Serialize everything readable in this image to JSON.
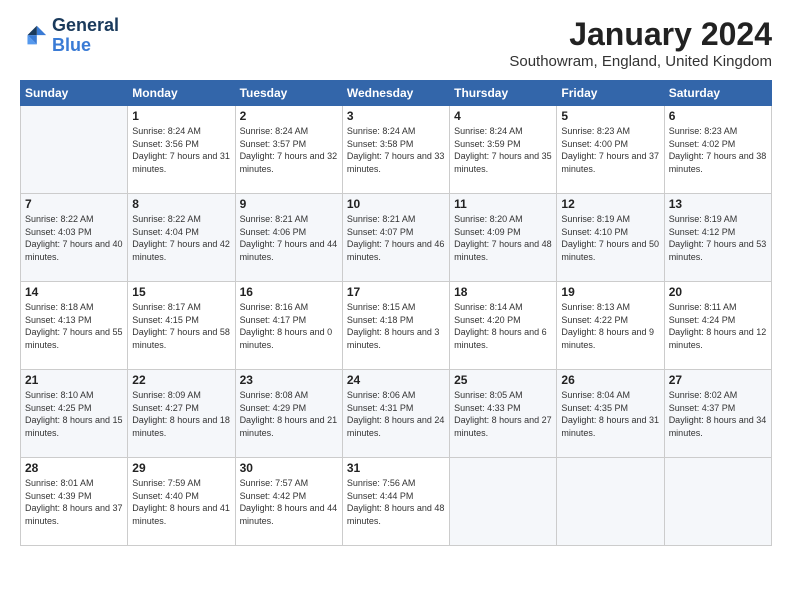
{
  "header": {
    "logo_line1": "General",
    "logo_line2": "Blue",
    "month": "January 2024",
    "location": "Southowram, England, United Kingdom"
  },
  "weekdays": [
    "Sunday",
    "Monday",
    "Tuesday",
    "Wednesday",
    "Thursday",
    "Friday",
    "Saturday"
  ],
  "weeks": [
    [
      {
        "day": "",
        "empty": true
      },
      {
        "day": "1",
        "sunrise": "8:24 AM",
        "sunset": "3:56 PM",
        "daylight": "7 hours and 31 minutes."
      },
      {
        "day": "2",
        "sunrise": "8:24 AM",
        "sunset": "3:57 PM",
        "daylight": "7 hours and 32 minutes."
      },
      {
        "day": "3",
        "sunrise": "8:24 AM",
        "sunset": "3:58 PM",
        "daylight": "7 hours and 33 minutes."
      },
      {
        "day": "4",
        "sunrise": "8:24 AM",
        "sunset": "3:59 PM",
        "daylight": "7 hours and 35 minutes."
      },
      {
        "day": "5",
        "sunrise": "8:23 AM",
        "sunset": "4:00 PM",
        "daylight": "7 hours and 37 minutes."
      },
      {
        "day": "6",
        "sunrise": "8:23 AM",
        "sunset": "4:02 PM",
        "daylight": "7 hours and 38 minutes."
      }
    ],
    [
      {
        "day": "7",
        "sunrise": "8:22 AM",
        "sunset": "4:03 PM",
        "daylight": "7 hours and 40 minutes."
      },
      {
        "day": "8",
        "sunrise": "8:22 AM",
        "sunset": "4:04 PM",
        "daylight": "7 hours and 42 minutes."
      },
      {
        "day": "9",
        "sunrise": "8:21 AM",
        "sunset": "4:06 PM",
        "daylight": "7 hours and 44 minutes."
      },
      {
        "day": "10",
        "sunrise": "8:21 AM",
        "sunset": "4:07 PM",
        "daylight": "7 hours and 46 minutes."
      },
      {
        "day": "11",
        "sunrise": "8:20 AM",
        "sunset": "4:09 PM",
        "daylight": "7 hours and 48 minutes."
      },
      {
        "day": "12",
        "sunrise": "8:19 AM",
        "sunset": "4:10 PM",
        "daylight": "7 hours and 50 minutes."
      },
      {
        "day": "13",
        "sunrise": "8:19 AM",
        "sunset": "4:12 PM",
        "daylight": "7 hours and 53 minutes."
      }
    ],
    [
      {
        "day": "14",
        "sunrise": "8:18 AM",
        "sunset": "4:13 PM",
        "daylight": "7 hours and 55 minutes."
      },
      {
        "day": "15",
        "sunrise": "8:17 AM",
        "sunset": "4:15 PM",
        "daylight": "7 hours and 58 minutes."
      },
      {
        "day": "16",
        "sunrise": "8:16 AM",
        "sunset": "4:17 PM",
        "daylight": "8 hours and 0 minutes."
      },
      {
        "day": "17",
        "sunrise": "8:15 AM",
        "sunset": "4:18 PM",
        "daylight": "8 hours and 3 minutes."
      },
      {
        "day": "18",
        "sunrise": "8:14 AM",
        "sunset": "4:20 PM",
        "daylight": "8 hours and 6 minutes."
      },
      {
        "day": "19",
        "sunrise": "8:13 AM",
        "sunset": "4:22 PM",
        "daylight": "8 hours and 9 minutes."
      },
      {
        "day": "20",
        "sunrise": "8:11 AM",
        "sunset": "4:24 PM",
        "daylight": "8 hours and 12 minutes."
      }
    ],
    [
      {
        "day": "21",
        "sunrise": "8:10 AM",
        "sunset": "4:25 PM",
        "daylight": "8 hours and 15 minutes."
      },
      {
        "day": "22",
        "sunrise": "8:09 AM",
        "sunset": "4:27 PM",
        "daylight": "8 hours and 18 minutes."
      },
      {
        "day": "23",
        "sunrise": "8:08 AM",
        "sunset": "4:29 PM",
        "daylight": "8 hours and 21 minutes."
      },
      {
        "day": "24",
        "sunrise": "8:06 AM",
        "sunset": "4:31 PM",
        "daylight": "8 hours and 24 minutes."
      },
      {
        "day": "25",
        "sunrise": "8:05 AM",
        "sunset": "4:33 PM",
        "daylight": "8 hours and 27 minutes."
      },
      {
        "day": "26",
        "sunrise": "8:04 AM",
        "sunset": "4:35 PM",
        "daylight": "8 hours and 31 minutes."
      },
      {
        "day": "27",
        "sunrise": "8:02 AM",
        "sunset": "4:37 PM",
        "daylight": "8 hours and 34 minutes."
      }
    ],
    [
      {
        "day": "28",
        "sunrise": "8:01 AM",
        "sunset": "4:39 PM",
        "daylight": "8 hours and 37 minutes."
      },
      {
        "day": "29",
        "sunrise": "7:59 AM",
        "sunset": "4:40 PM",
        "daylight": "8 hours and 41 minutes."
      },
      {
        "day": "30",
        "sunrise": "7:57 AM",
        "sunset": "4:42 PM",
        "daylight": "8 hours and 44 minutes."
      },
      {
        "day": "31",
        "sunrise": "7:56 AM",
        "sunset": "4:44 PM",
        "daylight": "8 hours and 48 minutes."
      },
      {
        "day": "",
        "empty": true
      },
      {
        "day": "",
        "empty": true
      },
      {
        "day": "",
        "empty": true
      }
    ]
  ],
  "labels": {
    "sunrise_label": "Sunrise:",
    "sunset_label": "Sunset:",
    "daylight_label": "Daylight:"
  }
}
